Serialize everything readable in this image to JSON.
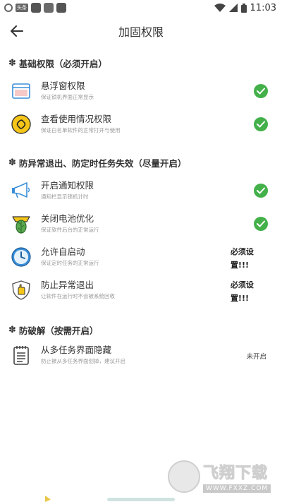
{
  "status_bar": {
    "time": "11:03",
    "icon_text": "头条"
  },
  "app_bar": {
    "title": "加固权限"
  },
  "sections": [
    {
      "title": "基础权限（必须开启）",
      "items": [
        {
          "title": "悬浮窗权限",
          "subtitle": "保证锁机界面正常显示",
          "status": "check",
          "icon": "window-icon"
        },
        {
          "title": "查看使用情况权限",
          "subtitle": "保证白名单软件的正常打开与使用",
          "status": "check",
          "icon": "link-badge-icon"
        }
      ]
    },
    {
      "title": "防异常退出、防定时任务失效（尽量开启）",
      "items": [
        {
          "title": "开启通知权限",
          "subtitle": "通知栏显示锁机计时",
          "status": "check",
          "icon": "megaphone-icon"
        },
        {
          "title": "关闭电池优化",
          "subtitle": "保证软件后台的正常运行",
          "status": "check",
          "icon": "leaf-battery-icon"
        },
        {
          "title": "允许自启动",
          "subtitle": "保证定时任务的正常运行",
          "status": "必须设置!!!",
          "icon": "clock-icon"
        },
        {
          "title": "防止异常退出",
          "subtitle": "让软件在运行时不会被系统回收",
          "status": "必须设置!!!",
          "icon": "shield-hand-icon"
        }
      ]
    },
    {
      "title": "防破解（按需开启）",
      "items": [
        {
          "title": "从多任务界面隐藏",
          "subtitle": "防止被从多任务界面划掉，建议开启",
          "status": "未开启",
          "icon": "notepad-icon"
        }
      ]
    }
  ],
  "watermark": {
    "cn": "飞翔下载",
    "en": "WWW.FXXZ.COM"
  },
  "colors": {
    "check_green": "#43b04a",
    "icon_blue": "#3a8fd8",
    "badge_yellow": "#f5c518"
  }
}
